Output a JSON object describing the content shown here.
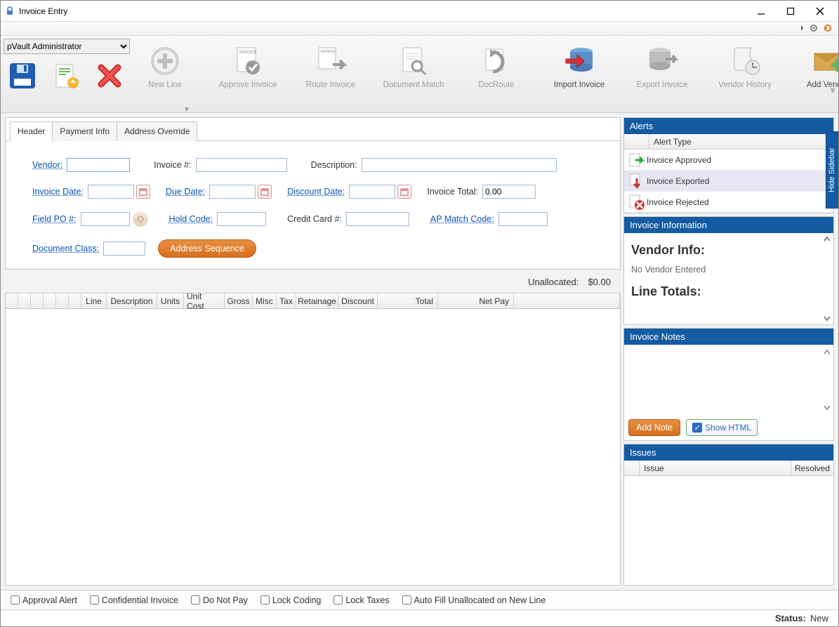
{
  "window": {
    "title": "Invoice Entry"
  },
  "toolbar": {
    "userSelect": "pVault Administrator",
    "items": [
      {
        "id": "new-line",
        "label": "New Line",
        "enabled": false
      },
      {
        "id": "approve-invoice",
        "label": "Approve Invoice",
        "enabled": false
      },
      {
        "id": "route-invoice",
        "label": "Route Invoice",
        "enabled": false
      },
      {
        "id": "document-match",
        "label": "Document Match",
        "enabled": false
      },
      {
        "id": "docroute",
        "label": "DocRoute",
        "enabled": false
      },
      {
        "id": "import-invoice",
        "label": "Import Invoice",
        "enabled": true
      },
      {
        "id": "export-invoice",
        "label": "Export Invoice",
        "enabled": false
      },
      {
        "id": "vendor-history",
        "label": "Vendor History",
        "enabled": false
      },
      {
        "id": "add-vendor",
        "label": "Add Vendor",
        "enabled": true
      }
    ]
  },
  "tabs": {
    "header": "Header",
    "payment": "Payment Info",
    "address": "Address Override"
  },
  "form": {
    "vendor": {
      "label": "Vendor:",
      "value": ""
    },
    "invoiceNum": {
      "label": "Invoice #:",
      "value": ""
    },
    "description": {
      "label": "Description:",
      "value": ""
    },
    "invoiceDate": {
      "label": "Invoice Date:",
      "value": ""
    },
    "dueDate": {
      "label": "Due Date:",
      "value": ""
    },
    "discountDate": {
      "label": "Discount Date:",
      "value": ""
    },
    "invoiceTotal": {
      "label": "Invoice Total:",
      "value": "0.00"
    },
    "fieldPO": {
      "label": "Field PO #:",
      "value": ""
    },
    "holdCode": {
      "label": "Hold Code:",
      "value": ""
    },
    "creditCard": {
      "label": "Credit Card #:",
      "value": ""
    },
    "apMatch": {
      "label": "AP Match Code:",
      "value": ""
    },
    "docClass": {
      "label": "Document Class:",
      "value": ""
    },
    "addrSeq": "Address Sequence"
  },
  "unallocated": {
    "label": "Unallocated:",
    "value": "$0.00"
  },
  "grid": {
    "cols": [
      "Line",
      "Description",
      "Units",
      "Unit Cost",
      "Gross",
      "Misc",
      "Tax",
      "Retainage",
      "Discount",
      "Total",
      "Net Pay"
    ]
  },
  "sidebar": {
    "alerts": {
      "title": "Alerts",
      "colLabel": "Alert Type",
      "items": [
        {
          "label": "Invoice Approved",
          "type": "approved"
        },
        {
          "label": "Invoice Exported",
          "type": "exported",
          "selected": true
        },
        {
          "label": "Invoice Rejected",
          "type": "rejected"
        }
      ]
    },
    "info": {
      "title": "Invoice Information",
      "vendorInfoHeading": "Vendor Info:",
      "noVendor": "No Vendor Entered",
      "lineTotalsHeading": "Line Totals:"
    },
    "notes": {
      "title": "Invoice Notes",
      "addNote": "Add Note",
      "showHtml": "Show HTML"
    },
    "issues": {
      "title": "Issues",
      "colIssue": "Issue",
      "colResolved": "Resolved"
    },
    "hideSidebar": "Hide Sidebar"
  },
  "checks": {
    "approvalAlert": "Approval Alert",
    "confidential": "Confidential Invoice",
    "doNotPay": "Do Not Pay",
    "lockCoding": "Lock Coding",
    "lockTaxes": "Lock Taxes",
    "autoFill": "Auto Fill Unallocated on New Line"
  },
  "status": {
    "label": "Status:",
    "value": "New"
  }
}
